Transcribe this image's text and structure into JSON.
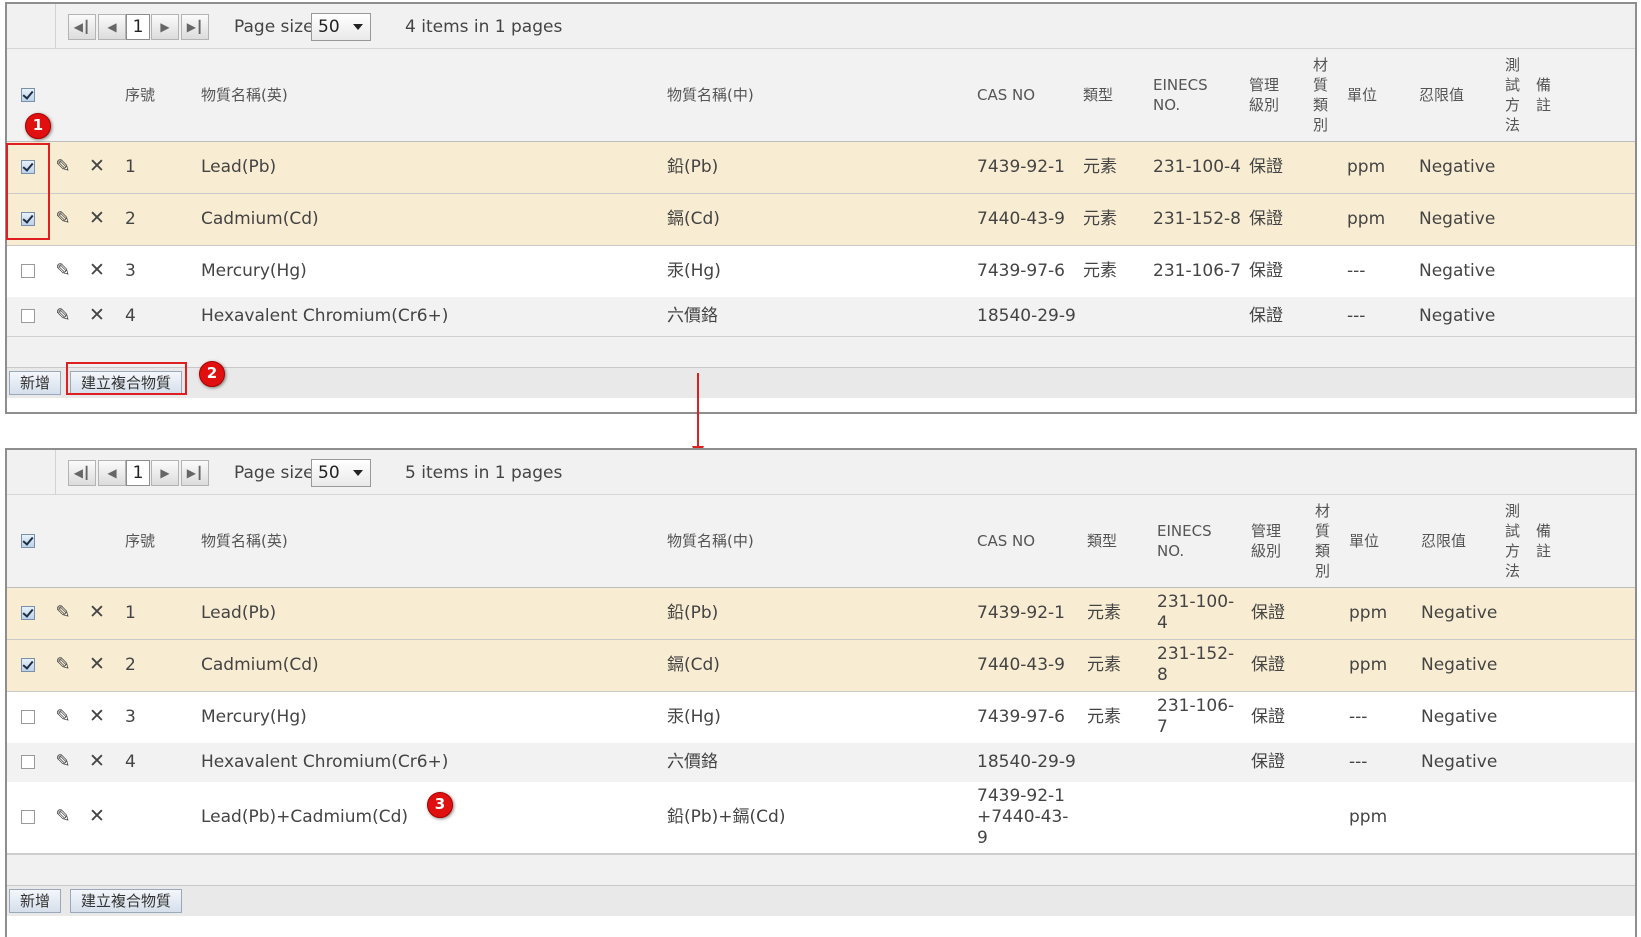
{
  "pager": {
    "first_icon": "first-page-icon",
    "prev_icon": "prev-page-icon",
    "next_icon": "next-page-icon",
    "last_icon": "last-page-icon",
    "page_number": "1",
    "page_size_label": "Page size:",
    "page_size_value": "50"
  },
  "headers": {
    "seq": "序號",
    "name_en": "物質名稱(英)",
    "name_zh": "物質名稱(中)",
    "cas": "CAS NO",
    "type": "類型",
    "einecs_1": "EINECS",
    "einecs_2": "NO.",
    "mgmt_1": "管理",
    "mgmt_2": "級別",
    "material": [
      "材",
      "質",
      "類",
      "別"
    ],
    "unit": "單位",
    "threshold": "忍限值",
    "test_method": [
      "測",
      "試",
      "方",
      "法"
    ],
    "remark": [
      "備",
      "註"
    ]
  },
  "grid1": {
    "info": "4 items in 1 pages",
    "rows": [
      {
        "checked": true,
        "seq": "1",
        "name_en": "Lead(Pb)",
        "name_zh": "鉛(Pb)",
        "cas": "7439-92-1",
        "type": "元素",
        "einecs": "231-100-4",
        "mgmt": "保證",
        "unit": "ppm",
        "threshold": "Negative"
      },
      {
        "checked": true,
        "seq": "2",
        "name_en": "Cadmium(Cd)",
        "name_zh": "鎘(Cd)",
        "cas": "7440-43-9",
        "type": "元素",
        "einecs": "231-152-8",
        "mgmt": "保證",
        "unit": "ppm",
        "threshold": "Negative"
      },
      {
        "checked": false,
        "seq": "3",
        "name_en": "Mercury(Hg)",
        "name_zh": "汞(Hg)",
        "cas": "7439-97-6",
        "type": "元素",
        "einecs": "231-106-7",
        "mgmt": "保證",
        "unit": "---",
        "threshold": "Negative"
      },
      {
        "checked": false,
        "seq": "4",
        "name_en": "Hexavalent Chromium(Cr6+)",
        "name_zh": "六價鉻",
        "cas": "18540-29-9",
        "type": "",
        "einecs": "",
        "mgmt": "保證",
        "unit": "---",
        "threshold": "Negative"
      }
    ]
  },
  "grid2": {
    "info": "5 items in 1 pages",
    "rows": [
      {
        "checked": true,
        "seq": "1",
        "name_en": "Lead(Pb)",
        "name_zh": "鉛(Pb)",
        "cas": "7439-92-1",
        "type": "元素",
        "einecs": "231-100-4",
        "mgmt": "保證",
        "unit": "ppm",
        "threshold": "Negative"
      },
      {
        "checked": true,
        "seq": "2",
        "name_en": "Cadmium(Cd)",
        "name_zh": "鎘(Cd)",
        "cas": "7440-43-9",
        "type": "元素",
        "einecs": "231-152-8",
        "mgmt": "保證",
        "unit": "ppm",
        "threshold": "Negative"
      },
      {
        "checked": false,
        "seq": "3",
        "name_en": "Mercury(Hg)",
        "name_zh": "汞(Hg)",
        "cas": "7439-97-6",
        "type": "元素",
        "einecs": "231-106-7",
        "mgmt": "保證",
        "unit": "---",
        "threshold": "Negative"
      },
      {
        "checked": false,
        "seq": "4",
        "name_en": "Hexavalent Chromium(Cr6+)",
        "name_zh": "六價鉻",
        "cas": "18540-29-9",
        "type": "",
        "einecs": "",
        "mgmt": "保證",
        "unit": "---",
        "threshold": "Negative"
      },
      {
        "checked": false,
        "seq": "",
        "name_en": "Lead(Pb)+Cadmium(Cd)",
        "name_zh": "鉛(Pb)+鎘(Cd)",
        "cas": "7439-92-1+7440-43-9",
        "type": "",
        "einecs": "",
        "mgmt": "",
        "unit": "ppm",
        "threshold": ""
      }
    ]
  },
  "toolbar": {
    "add_label": "新增",
    "create_compound_label": "建立複合物質"
  },
  "annotations": {
    "badge1": "1",
    "badge2": "2",
    "badge3": "3",
    "accent_color": "#e02020"
  },
  "icons": {
    "edit": "pencil-icon",
    "delete": "close-icon"
  }
}
